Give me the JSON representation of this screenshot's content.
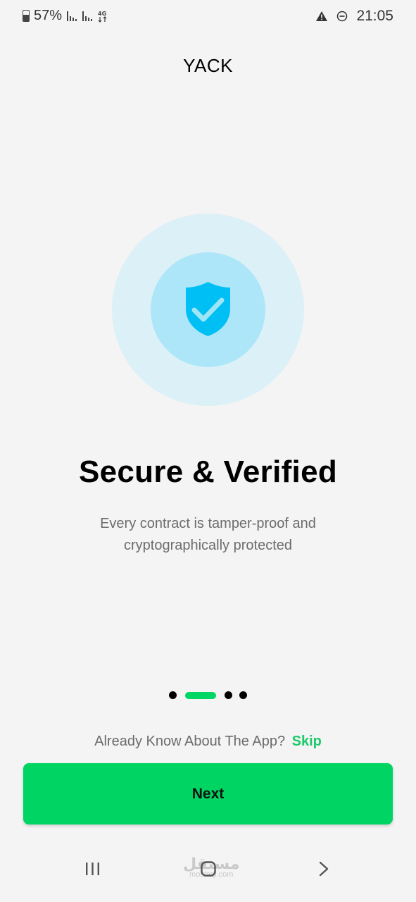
{
  "status_bar": {
    "battery_percent": "57%",
    "network_type": "4G",
    "time": "21:05",
    "icons": [
      "battery-icon",
      "signal-icon",
      "signal-icon",
      "network-4g-icon",
      "warning-icon",
      "do-not-disturb-icon"
    ]
  },
  "header": {
    "app_name": "YACK"
  },
  "hero": {
    "icon": "shield-check-icon",
    "colors": {
      "outer_circle": "#dcf0f7",
      "inner_circle": "#ade6f8",
      "shield": "#00bff5"
    }
  },
  "content": {
    "headline": "Secure & Verified",
    "subtitle": "Every contract is tamper-proof and cryptographically protected"
  },
  "pager": {
    "total": 4,
    "active_index": 1
  },
  "footer": {
    "prompt": "Already Know About The App?",
    "skip_label": "Skip",
    "next_label": "Next"
  },
  "nav_bar": {
    "icons": [
      "recents-icon",
      "home-icon",
      "back-icon"
    ]
  },
  "watermark": {
    "text": "مستقل",
    "subtext": "mostaql.com"
  },
  "colors": {
    "accent": "#00d563",
    "skip": "#1fc96a",
    "background": "#f4f4f4"
  }
}
